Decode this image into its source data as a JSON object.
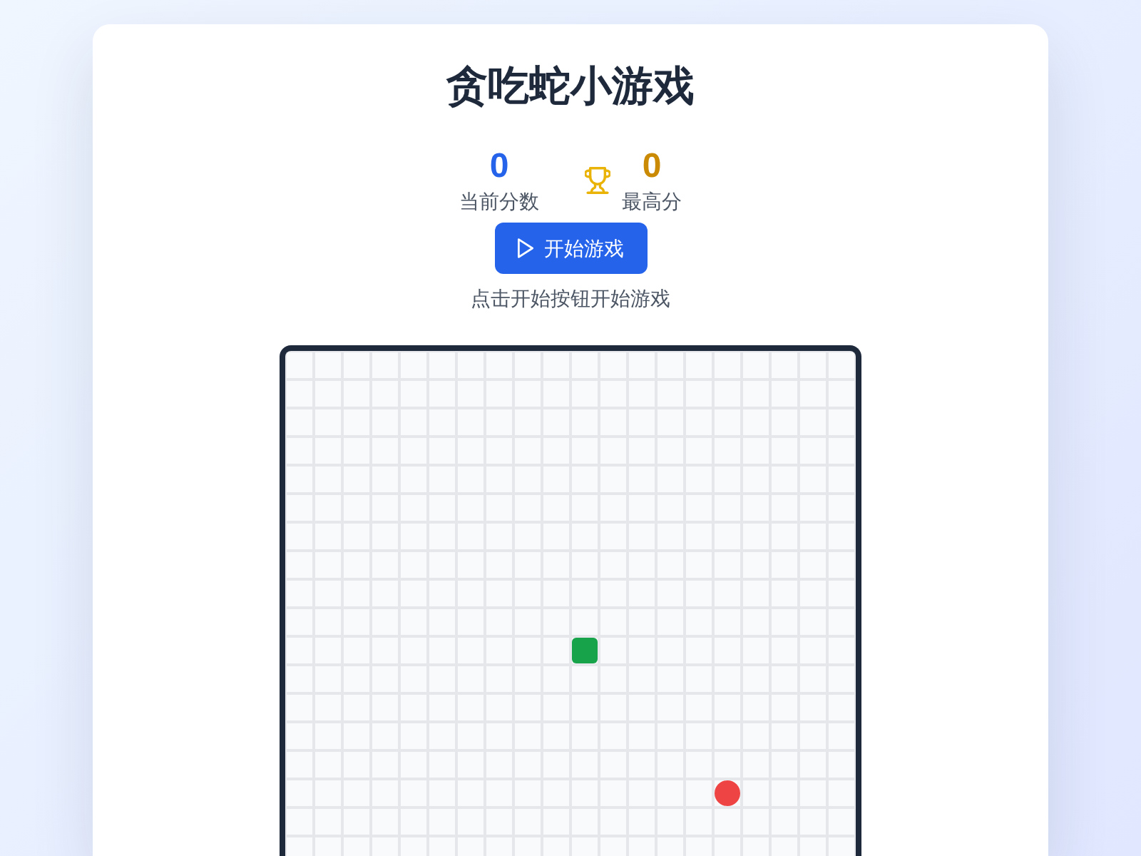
{
  "title": "贪吃蛇小游戏",
  "scores": [
    {
      "kind": "current",
      "value": "0",
      "label": "当前分数"
    },
    {
      "kind": "best",
      "value": "0",
      "label": "最高分"
    }
  ],
  "start_button": {
    "label": "开始游戏"
  },
  "hint": "点击开始按钮开始游戏"
}
